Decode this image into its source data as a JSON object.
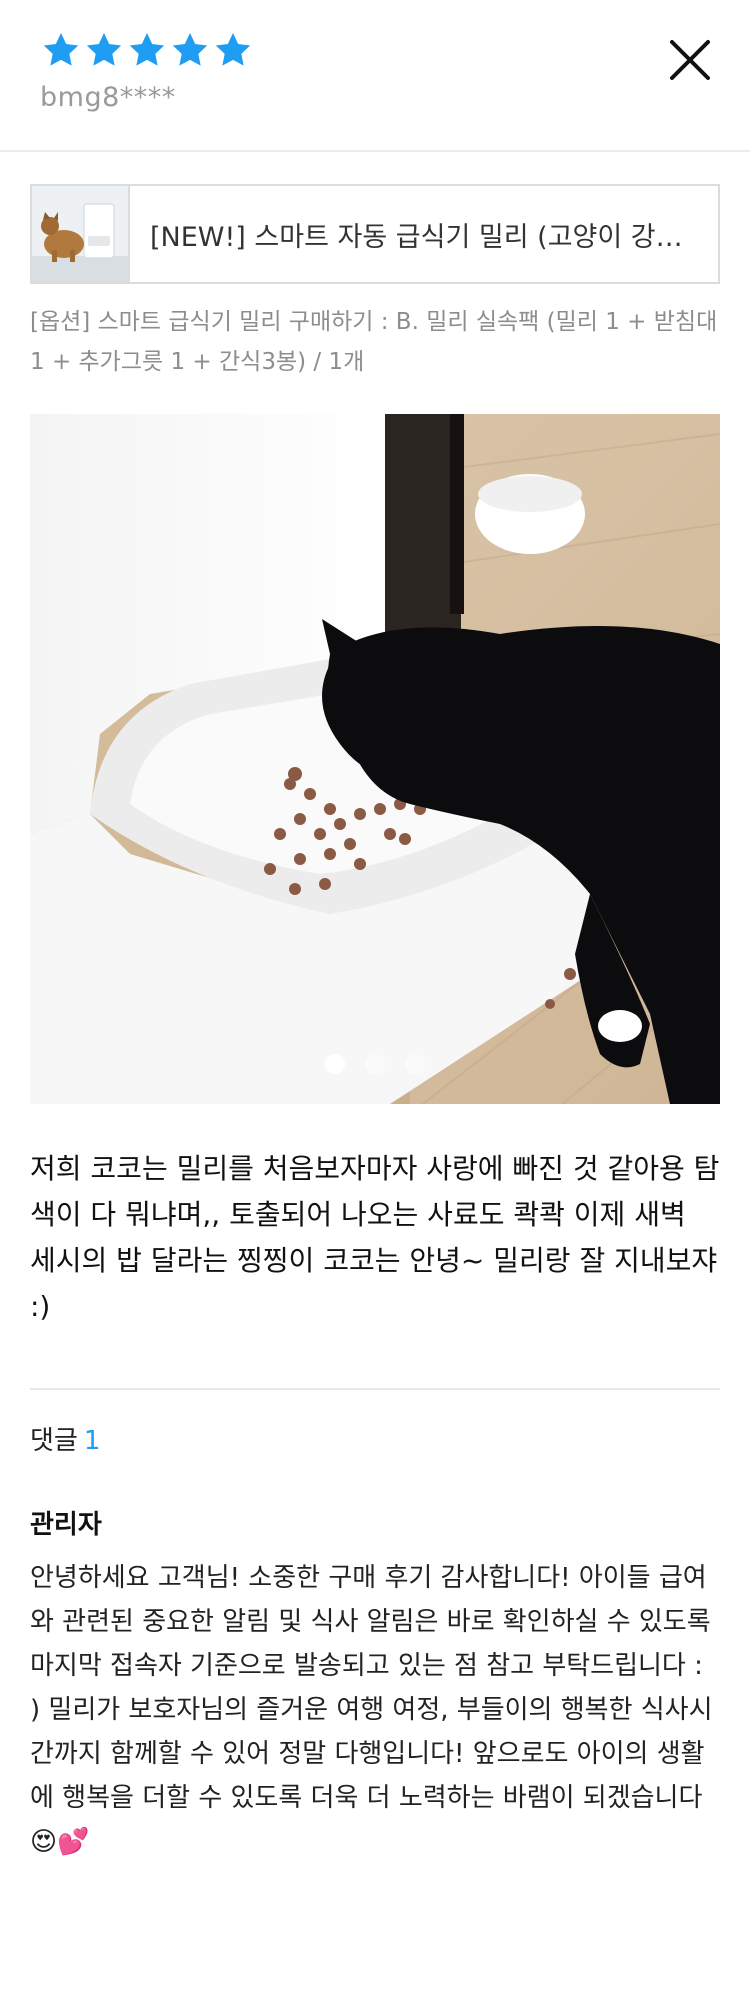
{
  "review": {
    "rating": 5,
    "max_rating": 5,
    "username": "bmg8****",
    "text": "저희 코코는 밀리를 처음보자마자 사랑에 빠진 것 같아용 탐색이 다 뭐냐며,, 토출되어 나오는 사료도 콱콱 이제 새벽 세시의 밥 달라는 찡찡이 코코는 안녕~ 밀리랑 잘 지내보쟈 :)"
  },
  "product": {
    "title": "[NEW!] 스마트 자동 급식기 밀리 (고양이 강아지 겸용)",
    "option": "[옵션] 스마트 급식기 밀리 구매하기 : B. 밀리 실속팩 (밀리 1 + 받침대 1 + 추가그릇 1 + 간식3봉) / 1개"
  },
  "gallery": {
    "image_count": 3,
    "active_index": 1
  },
  "comments": {
    "label": "댓글",
    "count": "1",
    "items": [
      {
        "author": "관리자",
        "text": "안녕하세요 고객님! 소중한 구매 후기 감사합니다! 아이들 급여와 관련된 중요한 알림 및 식사 알림은 바로 확인하실 수 있도록 마지막 접속자 기준으로 발송되고 있는 점 참고 부탁드립니다 : ) 밀리가 보호자님의 즐거운 여행 여정, 부들이의 행복한 식사시간까지 함께할 수 있어 정말 다행입니다! 앞으로도 아이의 생활에 행복을 더할 수 있도록 더욱 더 노력하는 바램이 되겠습니다😍💕"
      }
    ]
  },
  "colors": {
    "star": "#1e9df2",
    "accent": "#1e9df2",
    "muted_text": "#9a9a9a"
  },
  "icons": {
    "rating": "star-icon",
    "close": "close-icon"
  }
}
